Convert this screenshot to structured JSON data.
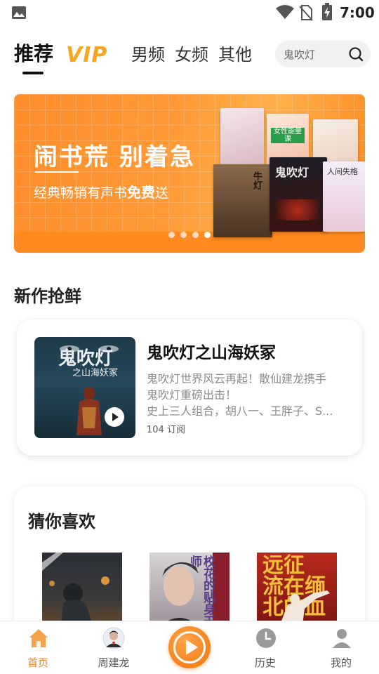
{
  "status_bar": {
    "time": "7:00"
  },
  "tabs": {
    "items": [
      "推荐",
      "男频",
      "女频",
      "其他"
    ],
    "vip_label": "VIP"
  },
  "search": {
    "placeholder": "鬼吹灯"
  },
  "banner": {
    "headline": "闹书荒 别着急",
    "sub_prefix": "经典畅销有声书",
    "sub_bold": "免费",
    "sub_suffix": "送",
    "dots_total": 4,
    "active_dot": 3,
    "book_titles": [
      "女性能量课",
      "鬼吹灯",
      "人间失格",
      "牛灯"
    ]
  },
  "new_section": {
    "title": "新作抢鲜",
    "book": {
      "title": "鬼吹灯之山海妖冢",
      "cover_title": "鬼吹灯",
      "cover_sub": "之山海妖冢",
      "desc": [
        "鬼吹灯世界风云再起！散仙建龙携手",
        "鬼吹灯重磅出击！",
        "史上三人组合，胡八一、王胖子、S..."
      ],
      "subs": "104 订阅"
    }
  },
  "guess_section": {
    "title": "猜你喜欢",
    "covers": [
      {
        "label": ""
      },
      {
        "label": "校花的贴身天师"
      },
      {
        "label": "远征 流在缅北的血"
      }
    ]
  },
  "bottom_nav": {
    "items": [
      {
        "label": "首页",
        "icon": "home-icon",
        "active": true
      },
      {
        "label": "周建龙",
        "icon": "avatar",
        "active": false
      },
      {
        "label": "历史",
        "icon": "clock-icon",
        "active": false
      },
      {
        "label": "我的",
        "icon": "user-icon",
        "active": false
      }
    ]
  },
  "colors": {
    "accent": "#f5831c",
    "banner": "#ff8d2a"
  }
}
